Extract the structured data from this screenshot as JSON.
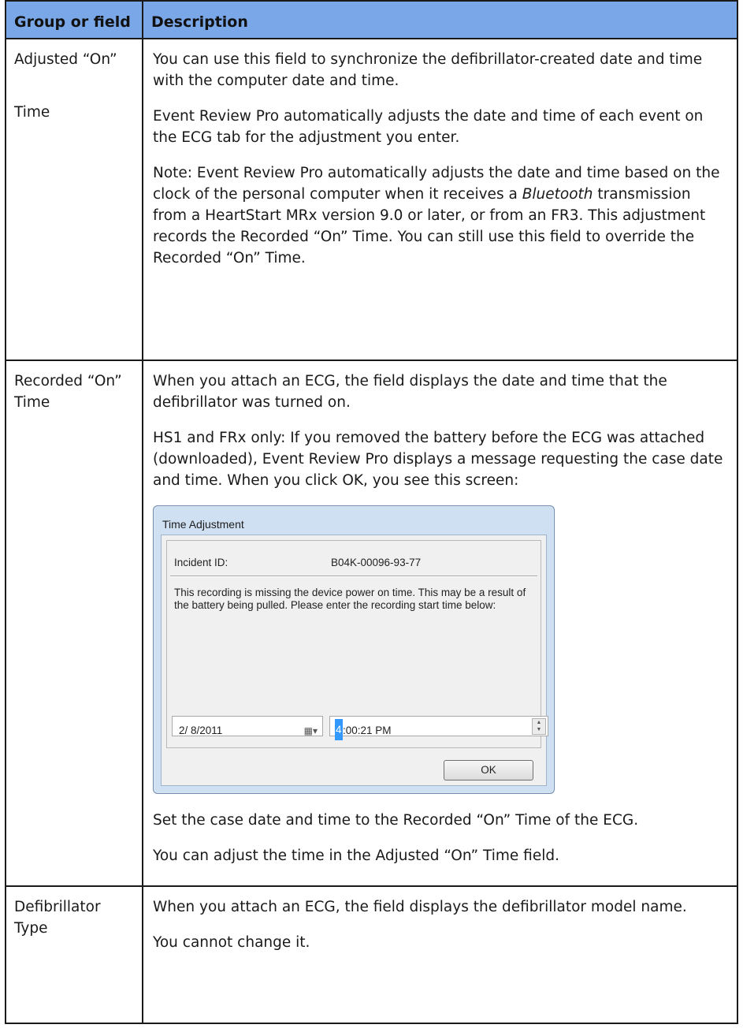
{
  "header": {
    "group": "Group or field",
    "description": "Description"
  },
  "rows": [
    {
      "group_line1": "Adjusted “On”",
      "group_line2": "Time",
      "paragraphs": [
        "You can use this field to synchronize the defibrillator-created date and time with the computer date and time.",
        "Event Review Pro automatically adjusts the date and time of each event on the ECG tab for the adjustment you enter."
      ],
      "note_before_italic": "Note: Event Review Pro automatically adjusts the date and time based on the clock of the personal computer when it receives a ",
      "note_italic": "Bluetooth",
      "note_after_italic": " transmission from a HeartStart MRx version 9.0 or later, or from an FR3. This adjustment records the Recorded “On” Time. You can still use this field to override the Recorded “On” Time."
    },
    {
      "group": "Recorded “On” Time",
      "paragraphs": [
        "When you attach an ECG, the field displays the date and time that the defibrillator was turned on.",
        "HS1 and FRx only: If you removed the battery before the ECG was attached (downloaded), Event Review Pro displays a message requesting the case date and time. When you click OK, you see this screen:"
      ],
      "after_dialog": [
        "Set the case date and time to the Recorded “On” Time of the ECG.",
        "You can adjust the time in the Adjusted “On” Time field."
      ]
    },
    {
      "group": "Defibrillator Type",
      "paragraphs": [
        "When you attach an ECG, the field displays the defibrillator model name.",
        "You cannot change it."
      ]
    }
  ],
  "dialog": {
    "title": "Time Adjustment",
    "incident_label": "Incident ID:",
    "incident_value": "B04K-00096-93-77",
    "message": "This recording is missing the device power on time.  This may be a result of the battery being pulled.  Please enter the recording start time below:",
    "date_value": "2/  8/2011",
    "time_hour": "4",
    "time_rest": ":00:21 PM",
    "ok_label": "OK",
    "calendar_icon": "calendar-dropdown-icon",
    "spin_icon": "spin-up-down-icon"
  }
}
